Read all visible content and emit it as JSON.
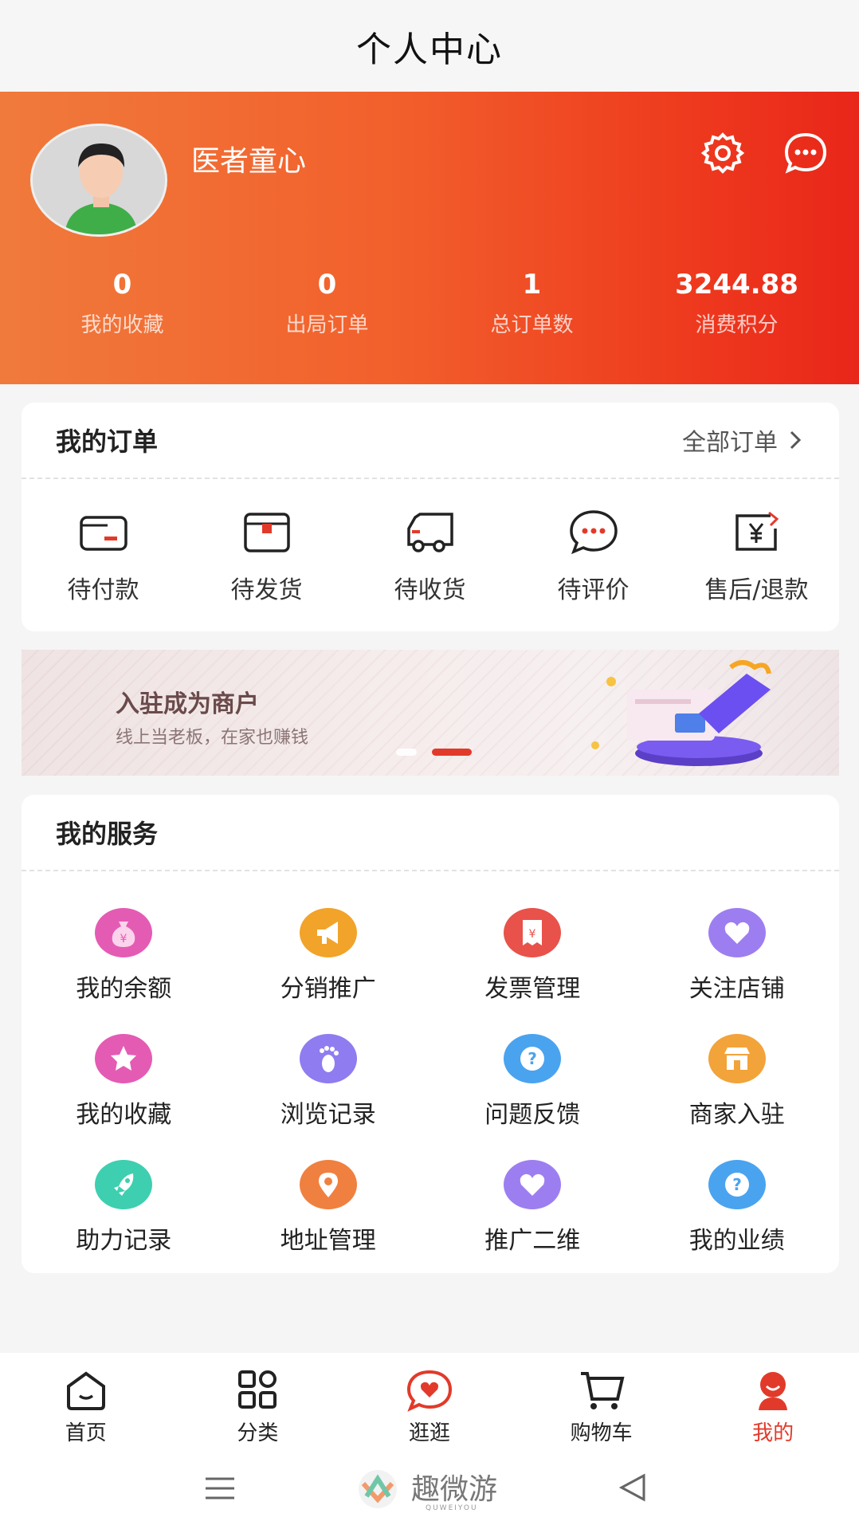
{
  "page": {
    "title": "个人中心"
  },
  "profile": {
    "username": "医者童心",
    "stats": [
      {
        "value": "0",
        "label": "我的收藏"
      },
      {
        "value": "0",
        "label": "出局订单"
      },
      {
        "value": "1",
        "label": "总订单数"
      },
      {
        "value": "3244.88",
        "label": "消费积分"
      }
    ]
  },
  "orders": {
    "title": "我的订单",
    "all_label": "全部订单",
    "items": [
      {
        "label": "待付款",
        "icon": "wallet-icon"
      },
      {
        "label": "待发货",
        "icon": "box-icon"
      },
      {
        "label": "待收货",
        "icon": "truck-icon"
      },
      {
        "label": "待评价",
        "icon": "chat-icon"
      },
      {
        "label": "售后/退款",
        "icon": "refund-icon"
      }
    ]
  },
  "banner": {
    "title": "入驻成为商户",
    "subtitle": "线上当老板，在家也赚钱"
  },
  "services": {
    "title": "我的服务",
    "items": [
      {
        "label": "我的余额",
        "icon": "money-bag-icon",
        "color": "#e45bb4"
      },
      {
        "label": "分销推广",
        "icon": "megaphone-icon",
        "color": "#f1a32a"
      },
      {
        "label": "发票管理",
        "icon": "invoice-icon",
        "color": "#e8524a"
      },
      {
        "label": "关注店铺",
        "icon": "heart-icon",
        "color": "#9d7ef0"
      },
      {
        "label": "我的收藏",
        "icon": "star-icon",
        "color": "#e45bb4"
      },
      {
        "label": "浏览记录",
        "icon": "footprint-icon",
        "color": "#8f7cf0"
      },
      {
        "label": "问题反馈",
        "icon": "question-icon",
        "color": "#4aa3ef"
      },
      {
        "label": "商家入驻",
        "icon": "store-icon",
        "color": "#f2a33a"
      },
      {
        "label": "助力记录",
        "icon": "rocket-icon",
        "color": "#3dcfb0"
      },
      {
        "label": "地址管理",
        "icon": "location-icon",
        "color": "#f08040"
      },
      {
        "label": "推广二维",
        "icon": "heart-icon",
        "color": "#9d7ef0"
      },
      {
        "label": "我的业绩",
        "icon": "question-icon",
        "color": "#4aa3ef"
      }
    ]
  },
  "tabbar": {
    "items": [
      {
        "label": "首页",
        "icon": "home-icon"
      },
      {
        "label": "分类",
        "icon": "grid-icon"
      },
      {
        "label": "逛逛",
        "icon": "heart-chat-icon"
      },
      {
        "label": "购物车",
        "icon": "cart-icon"
      },
      {
        "label": "我的",
        "icon": "user-icon"
      }
    ],
    "active_color": "#e23a2a"
  },
  "watermark": {
    "text": "趣微游",
    "sub": "QUWEIYOU"
  },
  "colors": {
    "accent": "#e23a2a",
    "header_start": "#f07a3c",
    "header_end": "#e9261a"
  }
}
